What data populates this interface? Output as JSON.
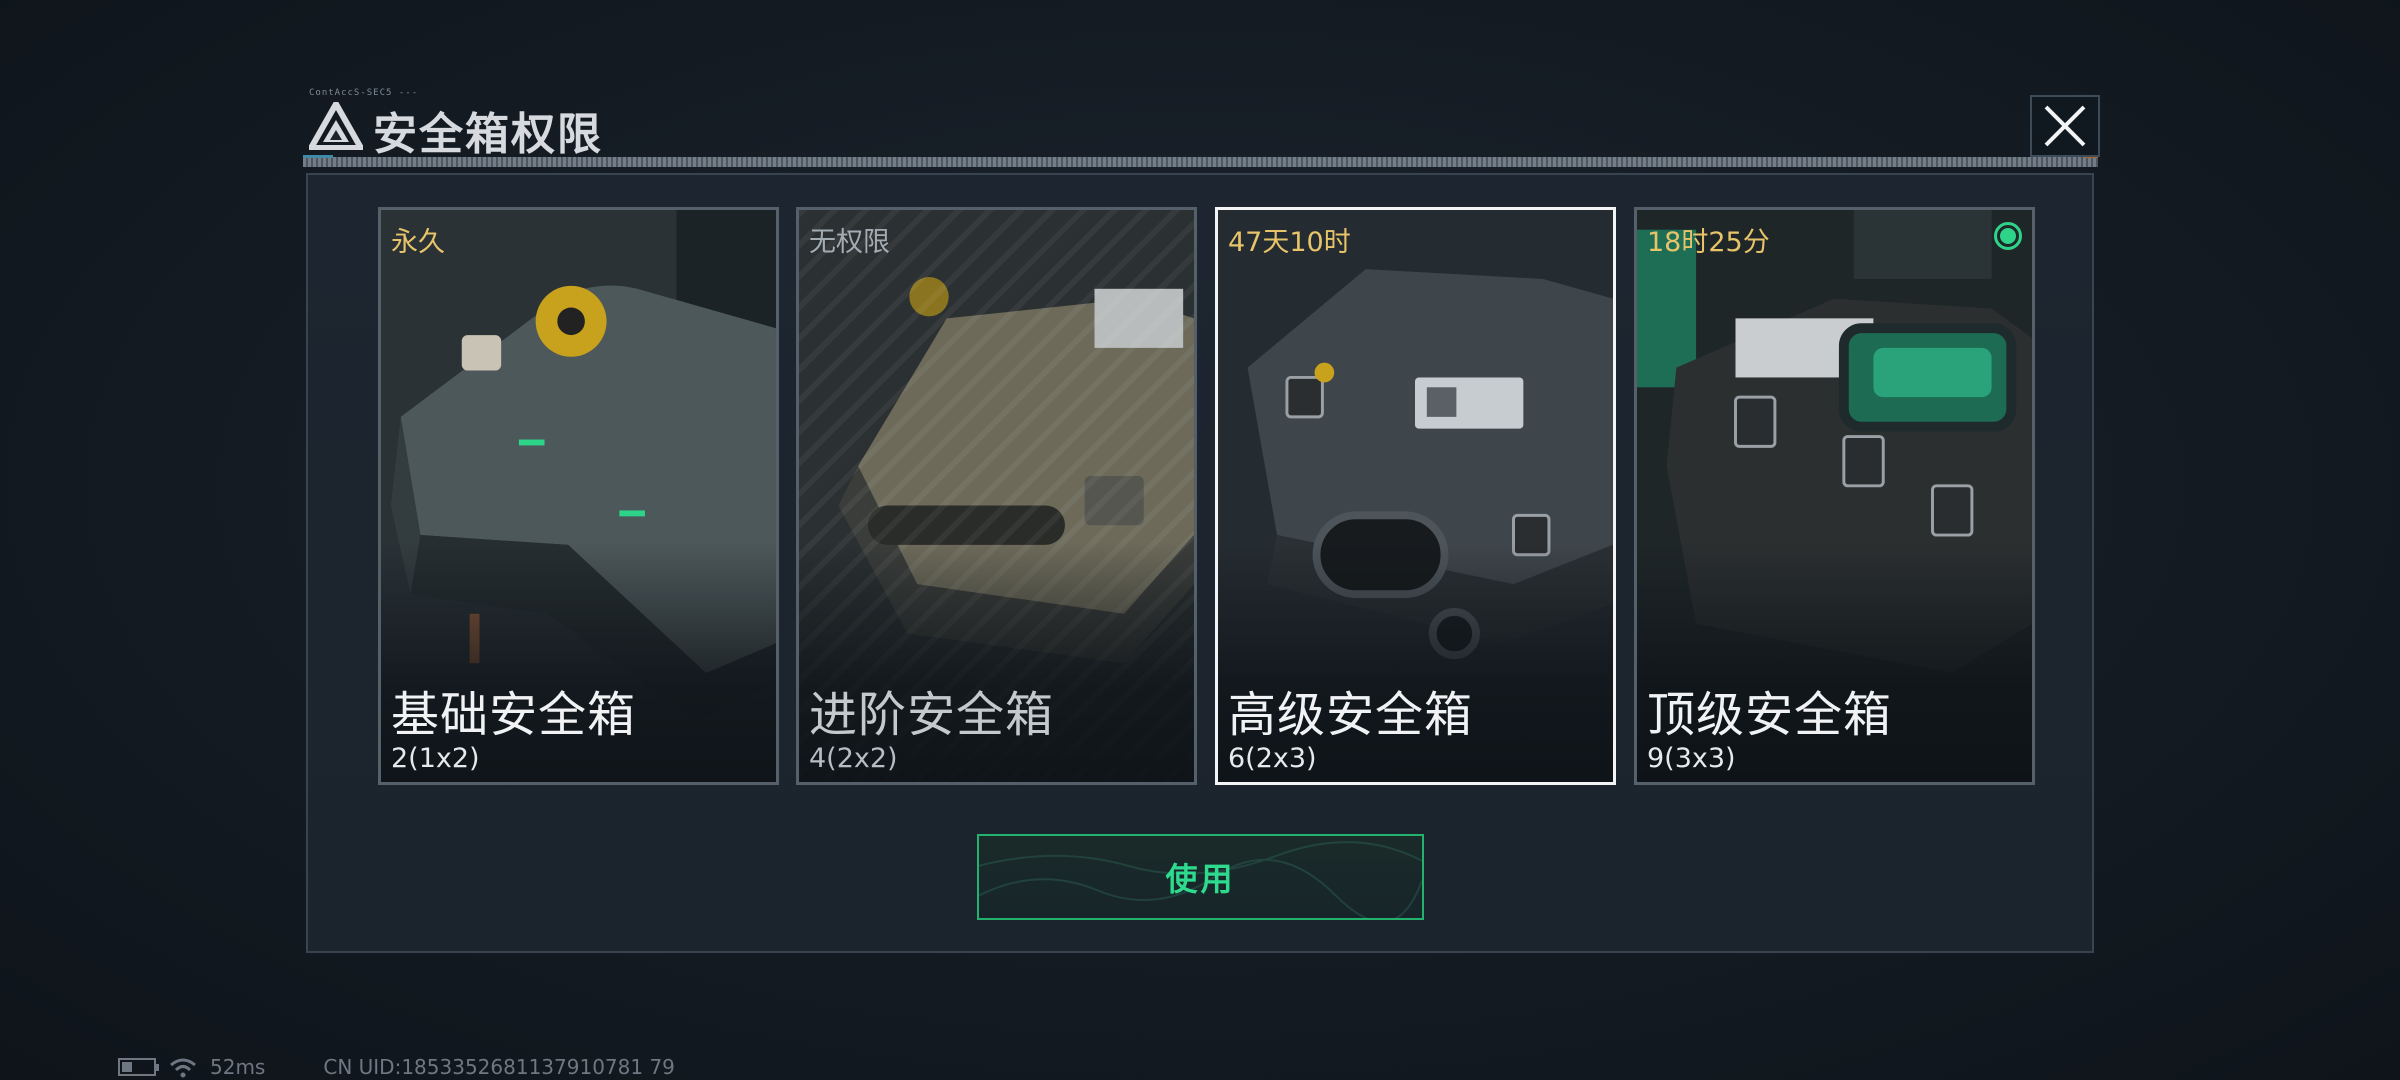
{
  "modal": {
    "title": "安全箱权限",
    "title_micro": "ContAccS-SEC5 ---",
    "use_button": "使用"
  },
  "cards": [
    {
      "status": "永久",
      "name": "基础安全箱",
      "size": "2(1x2)",
      "state": "available"
    },
    {
      "status": "无权限",
      "name": "进阶安全箱",
      "size": "4(2x2)",
      "state": "locked"
    },
    {
      "status": "47天10时",
      "name": "高级安全箱",
      "size": "6(2x3)",
      "state": "selected"
    },
    {
      "status": "18时25分",
      "name": "顶级安全箱",
      "size": "9(3x3)",
      "state": "equipped"
    }
  ],
  "footer": {
    "ping": "52ms",
    "uid": "CN UID:1853352681137910781 79"
  },
  "colors": {
    "accent_green": "#2edb8e",
    "status_gold": "#e7c36a",
    "panel_bg": "#1d2630"
  },
  "icons": {
    "title": "triangle-logo-icon",
    "close": "close-icon",
    "equipped": "equipped-dot-icon",
    "battery": "battery-icon",
    "wifi": "wifi-icon"
  }
}
